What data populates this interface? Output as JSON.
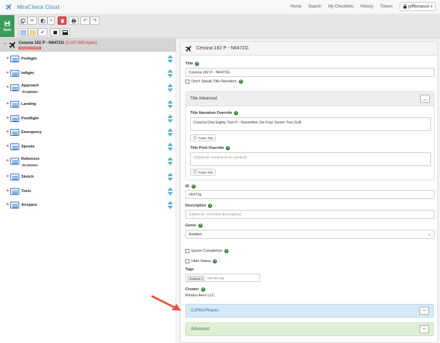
{
  "app": {
    "brand": "MiraCheck Cloud",
    "nav": [
      "Home",
      "Search",
      "My Checklists",
      "History",
      "Timers"
    ],
    "user": "jeffbonasso"
  },
  "toolbar": {
    "save_label": "Save"
  },
  "tree": {
    "root_title": "Cessna 182 P - N6472G",
    "root_bytes": "(3,197,483 bytes)",
    "root_badge": "Narration Override",
    "items": [
      {
        "label": "Preflight",
        "tag": ""
      },
      {
        "label": "Inflight",
        "tag": ""
      },
      {
        "label": "Approach",
        "tag": "ID: approach"
      },
      {
        "label": "Landing",
        "tag": ""
      },
      {
        "label": "Postflight",
        "tag": ""
      },
      {
        "label": "Emergency",
        "tag": ""
      },
      {
        "label": "Speeds",
        "tag": ""
      },
      {
        "label": "Reference",
        "tag": "ID: reference"
      },
      {
        "label": "Sketch",
        "tag": ""
      },
      {
        "label": "Tools",
        "tag": ""
      },
      {
        "label": "Airspace",
        "tag": ""
      }
    ]
  },
  "detail": {
    "header": "Cessna 182 P - N6472G",
    "title_label": "Title",
    "title_value": "Cessna 182 P - N6472G",
    "dont_speak_label": "Don't Speak Title Narration",
    "title_advanced": "Title Advanced",
    "narration_override_label": "Title Narration Override",
    "narration_override_value": "Cessna One Eighty Two P - November Six Four Seven Two Golf",
    "paste_title": "Paste Title",
    "print_override_label": "Title Print Override",
    "print_override_placeholder": "(Optional: content to be printed)",
    "id_label": "ID",
    "id_value": "n6472g",
    "description_label": "Description",
    "description_placeholder": "(Optional: checklist description)",
    "genre_label": "Genre",
    "genre_value": "Aviation",
    "ignore_completion": "Ignore Completion",
    "hide_status": "Hide Status",
    "tags_label": "Tags",
    "tag_value": "Cessna",
    "tag_placeholder": "Add new tag",
    "creator_label": "Creator",
    "creator_value": "Miralou Aero LLC",
    "copilot_phases": "CoPilot Phases",
    "advanced": "Advanced"
  },
  "colors": {
    "save_green": "#3a9b5c",
    "delete_red": "#d9534f",
    "copilot_band": "#d6e9f7",
    "advanced_band": "#dff0d8",
    "annotation_arrow": "#e2573e"
  }
}
